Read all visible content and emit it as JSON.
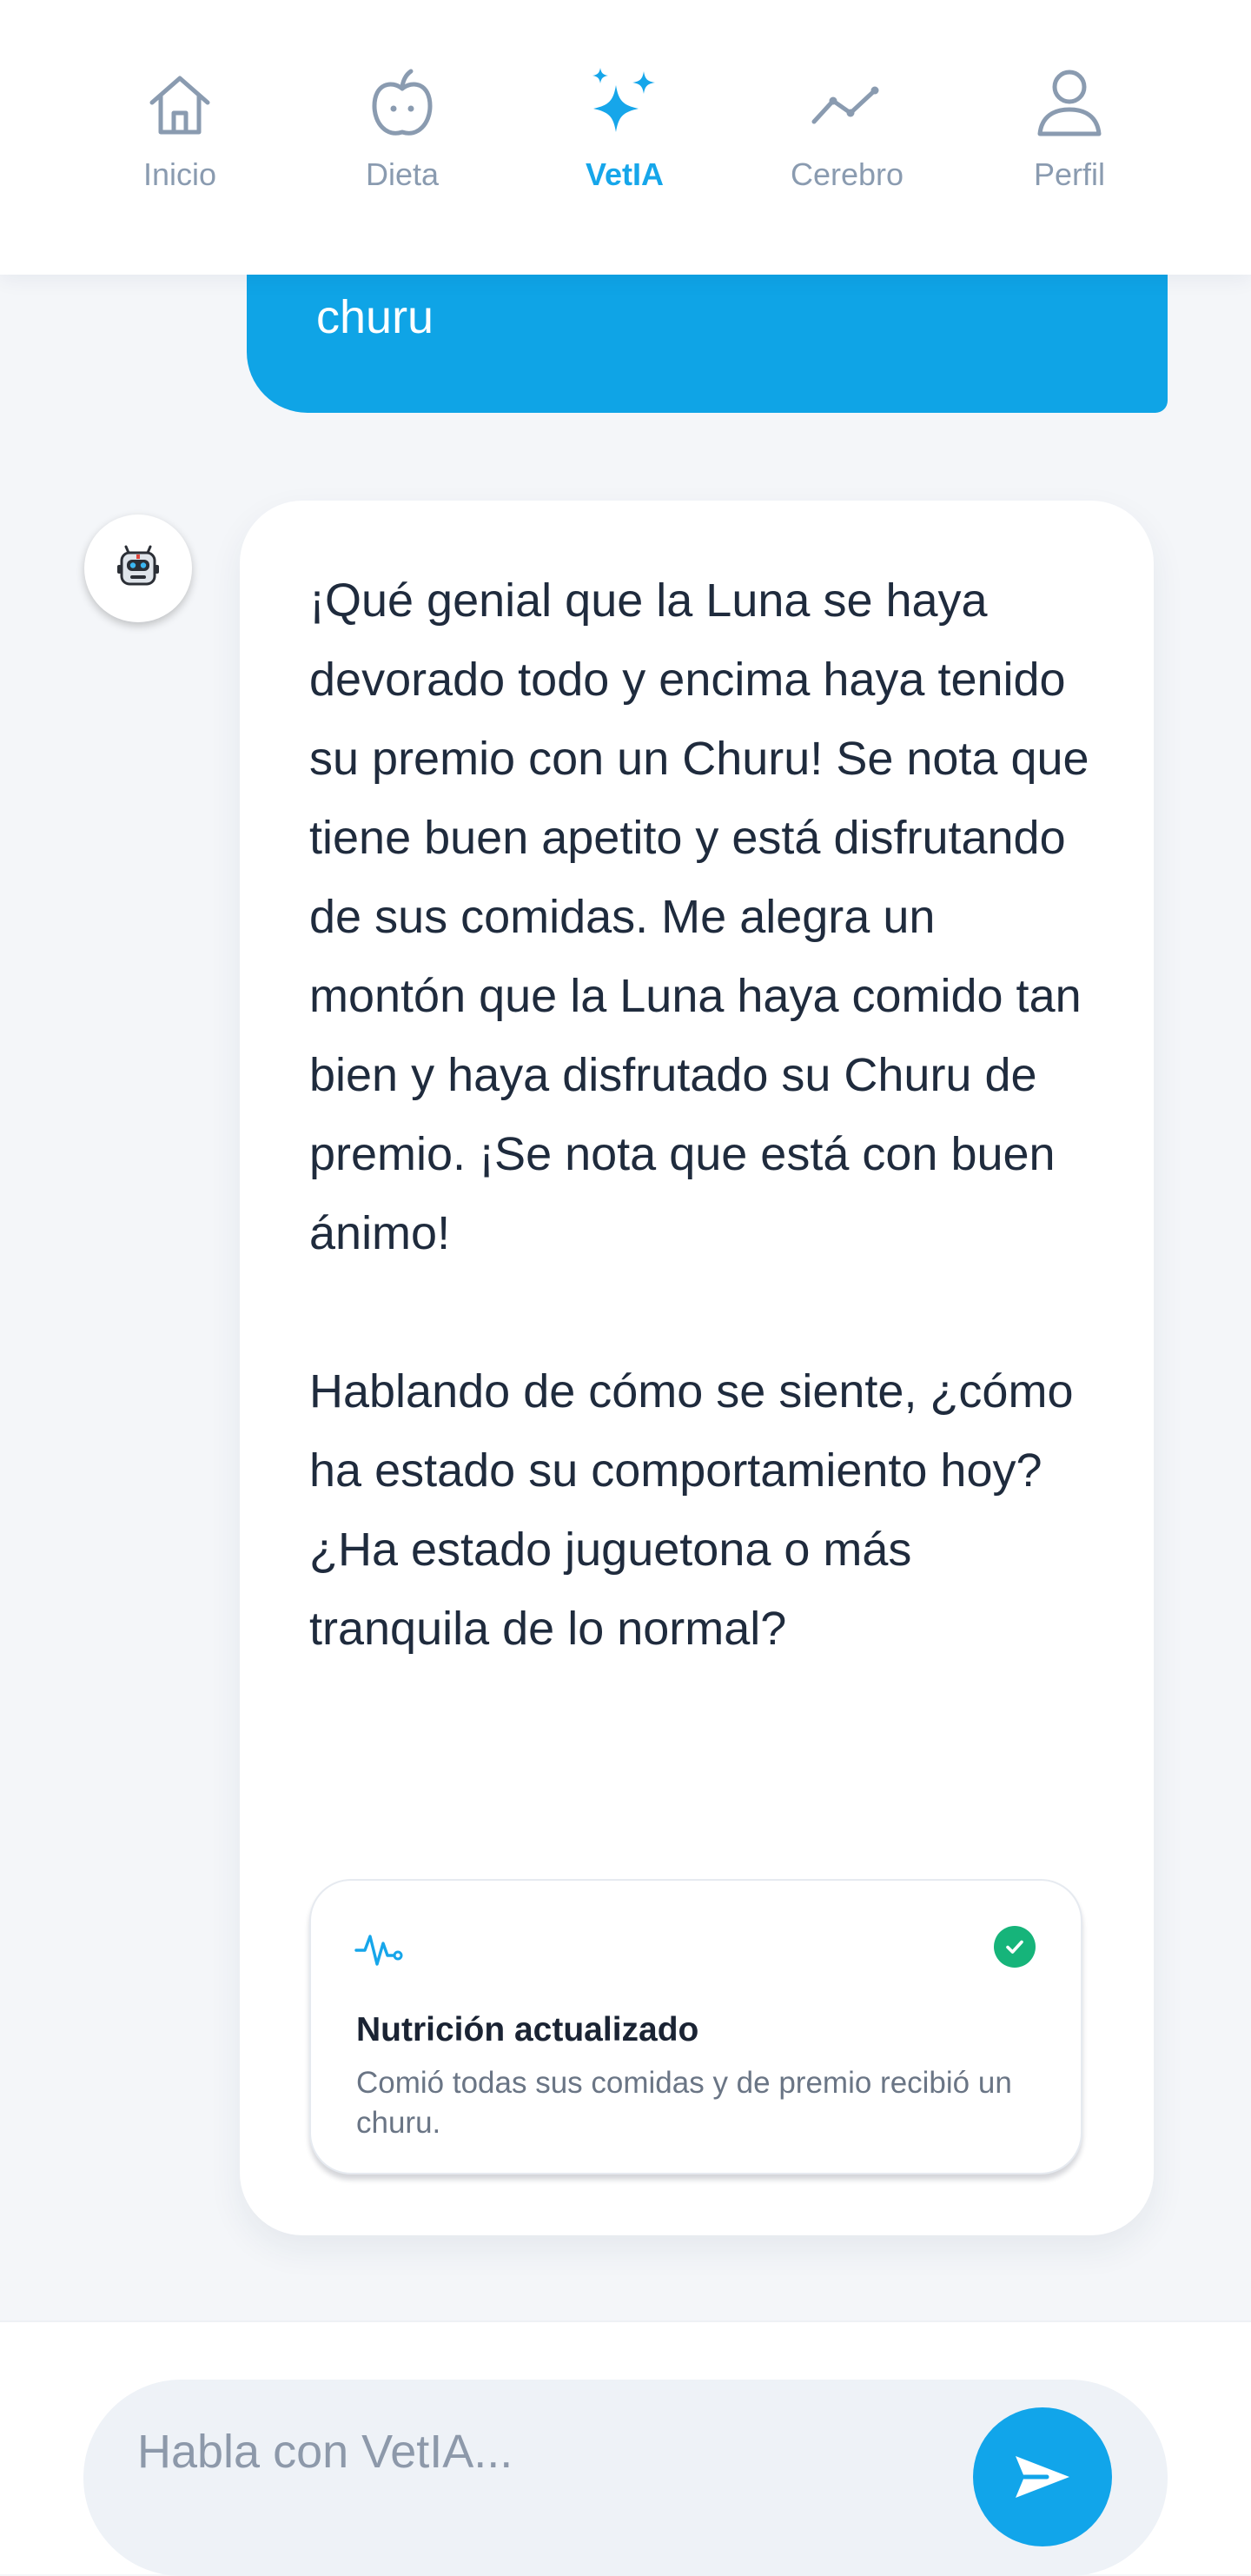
{
  "nav": {
    "items": [
      {
        "label": "Inicio",
        "icon": "home-icon",
        "active": false
      },
      {
        "label": "Dieta",
        "icon": "apple-icon",
        "active": false
      },
      {
        "label": "VetIA",
        "icon": "sparkles-icon",
        "active": true
      },
      {
        "label": "Cerebro",
        "icon": "trend-line-icon",
        "active": false
      },
      {
        "label": "Perfil",
        "icon": "user-icon",
        "active": false
      }
    ]
  },
  "chat": {
    "user_message": "churu",
    "bot_avatar_icon": "robot-icon",
    "bot_paragraphs": [
      "¡Qué genial que la Luna se haya devorado todo y encima haya tenido su premio con un Churu! Se nota que tiene buen apetito y está disfrutando de sus comidas. Me alegra un montón que la Luna haya comido tan bien y haya disfrutado su Churu de premio. ¡Se nota que está con buen ánimo!",
      "Hablando de cómo se siente, ¿cómo ha estado su comportamiento hoy? ¿Ha estado juguetona o más tranquila de lo normal?"
    ],
    "update_card": {
      "icon": "pulse-icon",
      "status_icon": "check-circle-icon",
      "title": "Nutrición actualizado",
      "description": "Comió todas sus comidas y de premio recibió un churu."
    }
  },
  "input": {
    "placeholder": "Habla con VetIA...",
    "send_icon": "send-icon"
  },
  "colors": {
    "accent": "#16a6ea",
    "nav_inactive": "#8a9bb0",
    "success": "#16b47a",
    "background": "#f4f6f9",
    "text": "#1f2b3d"
  }
}
